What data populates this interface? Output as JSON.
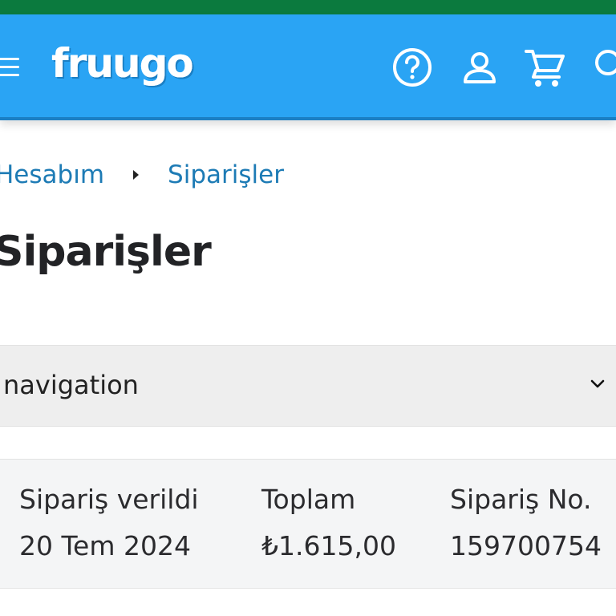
{
  "header": {
    "logo_text": "fruugo",
    "icons": [
      "menu-icon",
      "help-icon",
      "user-icon",
      "cart-icon",
      "search-icon"
    ],
    "brand_color": "#2aa4f4",
    "status_color": "#0b7a3e"
  },
  "breadcrumb": {
    "parent": "Hesabım",
    "current": "Siparişler"
  },
  "page": {
    "title": "Siparişler"
  },
  "navigation": {
    "label": "navigation"
  },
  "order": {
    "placed_label": "Sipariş verildi",
    "placed_value": "20 Tem 2024",
    "total_label": "Toplam",
    "total_value": "₺1.615,00",
    "number_label": "Sipariş No.",
    "number_value": "159700754"
  }
}
